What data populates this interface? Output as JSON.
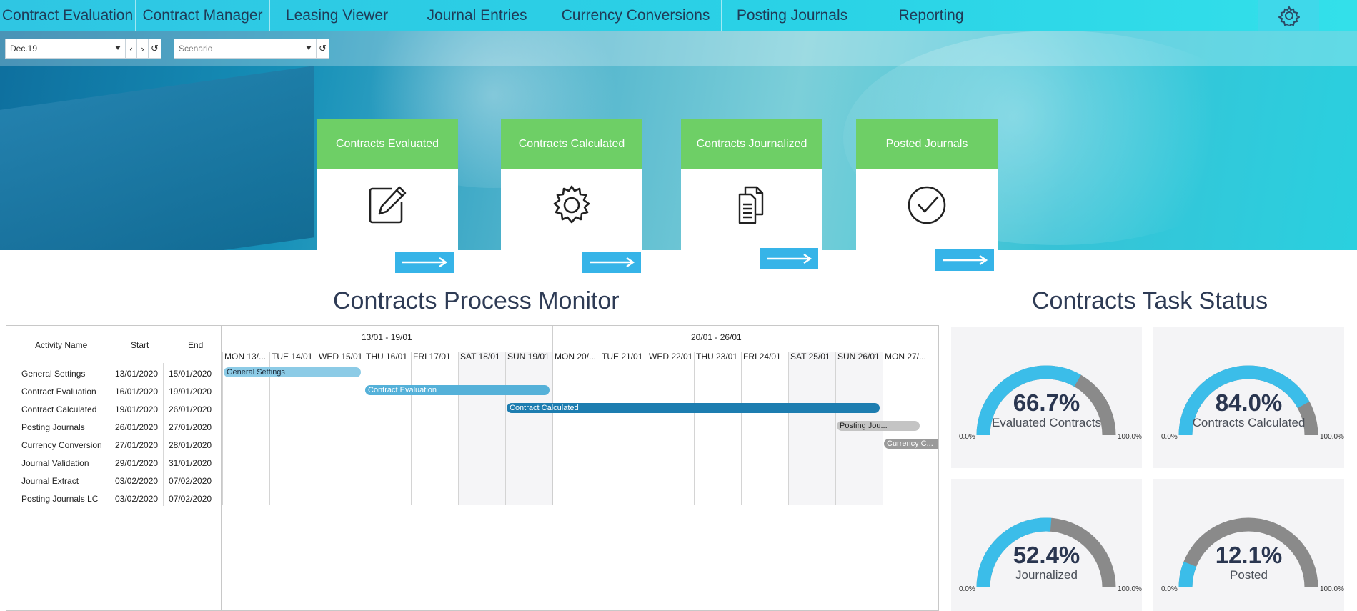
{
  "nav": {
    "items": [
      {
        "label": "Contract Evaluation"
      },
      {
        "label": "Contract Manager"
      },
      {
        "label": "Leasing Viewer"
      },
      {
        "label": "Journal Entries"
      },
      {
        "label": "Currency Conversions"
      },
      {
        "label": "Posting Journals"
      },
      {
        "label": "Reporting"
      }
    ],
    "settings_icon": "gear-icon"
  },
  "filters": {
    "period_value": "Dec.19",
    "scenario_placeholder": "Scenario"
  },
  "steps": [
    {
      "title": "Contracts Evaluated",
      "icon": "edit-icon"
    },
    {
      "title": "Contracts Calculated",
      "icon": "gear-icon"
    },
    {
      "title": "Contracts Journalized",
      "icon": "documents-icon"
    },
    {
      "title": "Posted Journals",
      "icon": "check-circle-icon"
    }
  ],
  "monitor": {
    "title": "Contracts Process Monitor",
    "columns": {
      "activity": "Activity Name",
      "start": "Start",
      "end": "End"
    },
    "weeks": [
      "13/01 - 19/01",
      "20/01 - 26/01"
    ],
    "days": [
      "MON 13/...",
      "TUE 14/01",
      "WED 15/01",
      "THU 16/01",
      "FRI 17/01",
      "SAT 18/01",
      "SUN 19/01",
      "MON 20/...",
      "TUE 21/01",
      "WED 22/01",
      "THU 23/01",
      "FRI 24/01",
      "SAT 25/01",
      "SUN 26/01",
      "MON 27/..."
    ],
    "activities": [
      {
        "name": "General Settings",
        "start": "13/01/2020",
        "end": "15/01/2020",
        "bar_label": "General Settings",
        "bar_start_day": 0,
        "bar_end_day": 2,
        "bar_color": "#8ccbe6",
        "bar_text_color": "#1d2d3d"
      },
      {
        "name": "Contract Evaluation",
        "start": "16/01/2020",
        "end": "19/01/2020",
        "bar_label": "Contract Evaluation",
        "bar_start_day": 3,
        "bar_end_day": 6,
        "bar_color": "#55b1d9",
        "bar_text_color": "#ffffff"
      },
      {
        "name": "Contract Calculated",
        "start": "19/01/2020",
        "end": "26/01/2020",
        "bar_label": "Contract Calculated",
        "bar_start_day": 6,
        "bar_end_day": 13,
        "bar_color": "#1d7db0",
        "bar_text_color": "#ffffff"
      },
      {
        "name": "Posting Journals",
        "start": "26/01/2020",
        "end": "27/01/2020",
        "bar_label": "Posting Jou...",
        "bar_start_day": 13,
        "bar_end_day": 14,
        "bar_color": "#c4c4c4",
        "bar_text_color": "#222222"
      },
      {
        "name": "Currency Conversion",
        "start": "27/01/2020",
        "end": "28/01/2020",
        "bar_label": "Currency C...",
        "bar_start_day": 14,
        "bar_end_day": 15,
        "bar_color": "#9a9a9a",
        "bar_text_color": "#ffffff"
      },
      {
        "name": "Journal Validation",
        "start": "29/01/2020",
        "end": "31/01/2020"
      },
      {
        "name": "Journal Extract",
        "start": "03/02/2020",
        "end": "07/02/2020"
      },
      {
        "name": "Posting Journals LC",
        "start": "03/02/2020",
        "end": "07/02/2020"
      }
    ]
  },
  "task_status": {
    "title": "Contracts Task Status",
    "gauges": [
      {
        "value_text": "66.7%",
        "value": 66.7,
        "label": "Evaluated Contracts",
        "min": "0.0%",
        "max": "100.0%"
      },
      {
        "value_text": "84.0%",
        "value": 84.0,
        "label": "Contracts Calculated",
        "min": "0.0%",
        "max": "100.0%"
      },
      {
        "value_text": "52.4%",
        "value": 52.4,
        "label": "Journalized",
        "min": "0.0%",
        "max": "100.0%"
      },
      {
        "value_text": "12.1%",
        "value": 12.1,
        "label": "Posted",
        "min": "0.0%",
        "max": "100.0%"
      }
    ],
    "colors": {
      "fill": "#3bbde9",
      "track": "#8a8a8a"
    }
  }
}
